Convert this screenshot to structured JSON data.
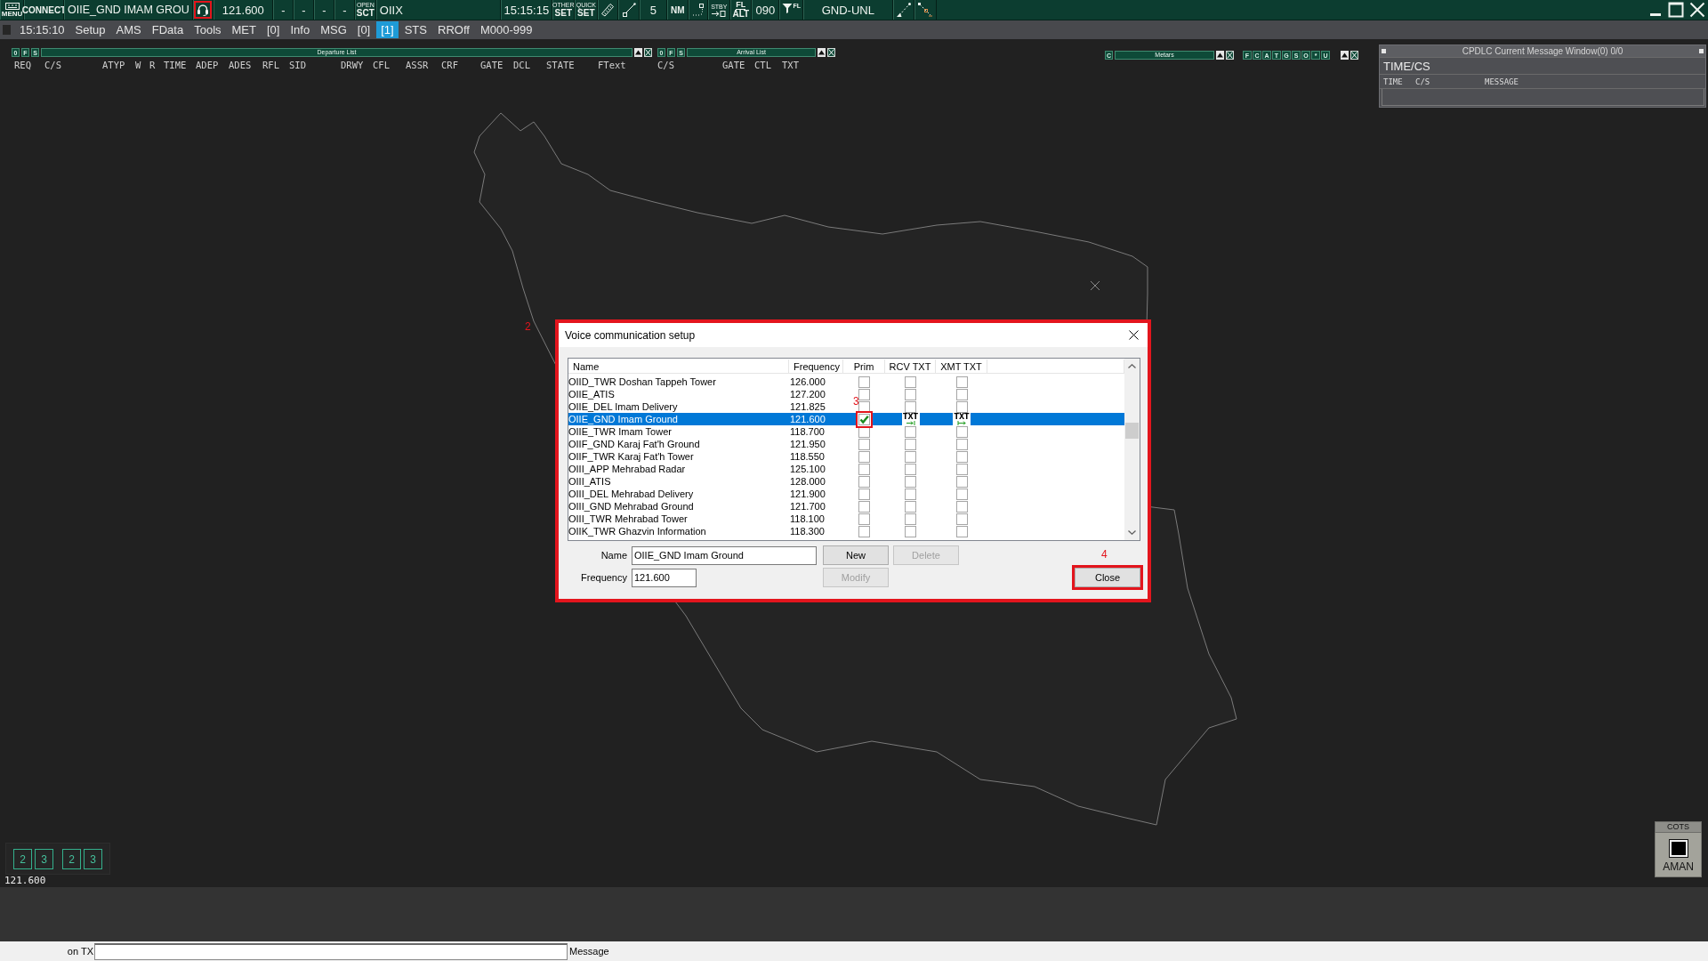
{
  "toolbar": {
    "menu_label": "MENU",
    "connect": "CONNECT",
    "position": "OIIE_GND IMAM GROU",
    "headset_highlighted": true,
    "frequency": "121.600",
    "slots": [
      "-",
      "-",
      "-",
      "-"
    ],
    "sector_button": {
      "top": "OPEN",
      "bottom": "SCT"
    },
    "sector": "OIIX",
    "clock": "15:15:15",
    "other_set": {
      "top": "OTHER",
      "bottom": "SET"
    },
    "quick_set": {
      "top": "QUICK",
      "bottom": "SET"
    },
    "range": "5",
    "range_unit": "NM",
    "standby": "STBY",
    "level_mode": {
      "top": "FL",
      "bottom": "ALT"
    },
    "level_value": "090",
    "filter_label": "FL",
    "ground_mode": "GND-UNL"
  },
  "menu_bar": {
    "clock": "15:15:10",
    "items": [
      {
        "label": "Setup",
        "selected": false
      },
      {
        "label": "AMS",
        "selected": false
      },
      {
        "label": "FData",
        "selected": false
      },
      {
        "label": "Tools",
        "selected": false
      },
      {
        "label": "MET",
        "selected": false
      },
      {
        "label": "[0]",
        "selected": false
      },
      {
        "label": "Info",
        "selected": false
      },
      {
        "label": "MSG",
        "selected": false
      },
      {
        "label": "[0]",
        "selected": false
      },
      {
        "label": "[1]",
        "selected": true
      },
      {
        "label": "STS",
        "selected": false
      },
      {
        "label": "RROff",
        "selected": false
      },
      {
        "label": "M000-999",
        "selected": false
      }
    ]
  },
  "departure_list": {
    "buttons": [
      "0",
      "F",
      "S"
    ],
    "title": "Departure List",
    "columns": [
      "REQ",
      "C/S",
      "ATYP",
      "W",
      "R",
      "TIME",
      "ADEP",
      "ADES",
      "RFL",
      "SID",
      "DRWY",
      "CFL",
      "ASSR",
      "CRF",
      "GATE",
      "DCL",
      "STATE",
      "FText"
    ]
  },
  "arrival_list": {
    "buttons": [
      "0",
      "F",
      "S"
    ],
    "title": "Arrival List",
    "columns": [
      "C/S",
      "GATE",
      "CTL",
      "TXT"
    ]
  },
  "metars": {
    "buttons": [
      "C"
    ],
    "title": "Metars",
    "filters": [
      "F",
      "C",
      "A",
      "T",
      "G",
      "S",
      "O",
      "*",
      "U"
    ]
  },
  "cpdlc": {
    "title": "CPDLC Current Message Window(0) 0/0",
    "heading": "TIME/CS",
    "columns": [
      "TIME",
      "C/S",
      "MESSAGE"
    ]
  },
  "dialog": {
    "title": "Voice communication setup",
    "highlighted": true,
    "columns": [
      "Name",
      "Frequency",
      "Prim",
      "RCV TXT",
      "XMT TXT"
    ],
    "rows": [
      {
        "name": "OIID_TWR Doshan Tappeh Tower",
        "frequency": "126.000",
        "selected": false,
        "prim": false,
        "rcv_txt": false,
        "xmt_txt": false,
        "highlighted": false
      },
      {
        "name": "OIIE_ATIS",
        "frequency": "127.200",
        "selected": false,
        "prim": false,
        "rcv_txt": false,
        "xmt_txt": false,
        "highlighted": false
      },
      {
        "name": "OIIE_DEL Imam Delivery",
        "frequency": "121.825",
        "selected": false,
        "prim": false,
        "rcv_txt": false,
        "xmt_txt": false,
        "highlighted": false
      },
      {
        "name": "OIIE_GND Imam Ground",
        "frequency": "121.600",
        "selected": true,
        "prim": true,
        "rcv_txt": true,
        "rcv_label": "TXT",
        "xmt_txt": true,
        "xmt_label": "TXT",
        "highlighted": true
      },
      {
        "name": "OIIE_TWR Imam Tower",
        "frequency": "118.700",
        "selected": false,
        "prim": false,
        "rcv_txt": false,
        "xmt_txt": false,
        "highlighted": false
      },
      {
        "name": "OIIF_GND Karaj Fat'h Ground",
        "frequency": "121.950",
        "selected": false,
        "prim": false,
        "rcv_txt": false,
        "xmt_txt": false,
        "highlighted": false
      },
      {
        "name": "OIIF_TWR Karaj Fat'h Tower",
        "frequency": "118.550",
        "selected": false,
        "prim": false,
        "rcv_txt": false,
        "xmt_txt": false,
        "highlighted": false
      },
      {
        "name": "OIII_APP Mehrabad Radar",
        "frequency": "125.100",
        "selected": false,
        "prim": false,
        "rcv_txt": false,
        "xmt_txt": false,
        "highlighted": false
      },
      {
        "name": "OIII_ATIS",
        "frequency": "128.000",
        "selected": false,
        "prim": false,
        "rcv_txt": false,
        "xmt_txt": false,
        "highlighted": false
      },
      {
        "name": "OIII_DEL Mehrabad Delivery",
        "frequency": "121.900",
        "selected": false,
        "prim": false,
        "rcv_txt": false,
        "xmt_txt": false,
        "highlighted": false
      },
      {
        "name": "OIII_GND Mehrabad Ground",
        "frequency": "121.700",
        "selected": false,
        "prim": false,
        "rcv_txt": false,
        "xmt_txt": false,
        "highlighted": false
      },
      {
        "name": "OIII_TWR Mehrabad Tower",
        "frequency": "118.100",
        "selected": false,
        "prim": false,
        "rcv_txt": false,
        "xmt_txt": false,
        "highlighted": false
      },
      {
        "name": "OIIK_TWR Ghazvin Information",
        "frequency": "118.300",
        "selected": false,
        "prim": false,
        "rcv_txt": false,
        "xmt_txt": false,
        "highlighted": false
      }
    ],
    "name_label": "Name",
    "name_value": "OIIE_GND Imam Ground",
    "frequency_label": "Frequency",
    "frequency_value": "121.600",
    "buttons": [
      {
        "label": "New",
        "disabled": false,
        "highlighted": false
      },
      {
        "label": "Delete",
        "disabled": true,
        "highlighted": false
      },
      {
        "label": "Modify",
        "disabled": true,
        "highlighted": false
      },
      {
        "label": "Close",
        "disabled": false,
        "highlighted": true
      }
    ]
  },
  "callouts": [
    "2",
    "3",
    "4"
  ],
  "sector_panel": {
    "buttons": [
      "2",
      "3",
      "2",
      "3"
    ],
    "frequency": "121.600"
  },
  "cots": {
    "header": "COTS",
    "label": "AMAN"
  },
  "message_bar": {
    "label": "on TX",
    "trailing_label": "Message"
  }
}
